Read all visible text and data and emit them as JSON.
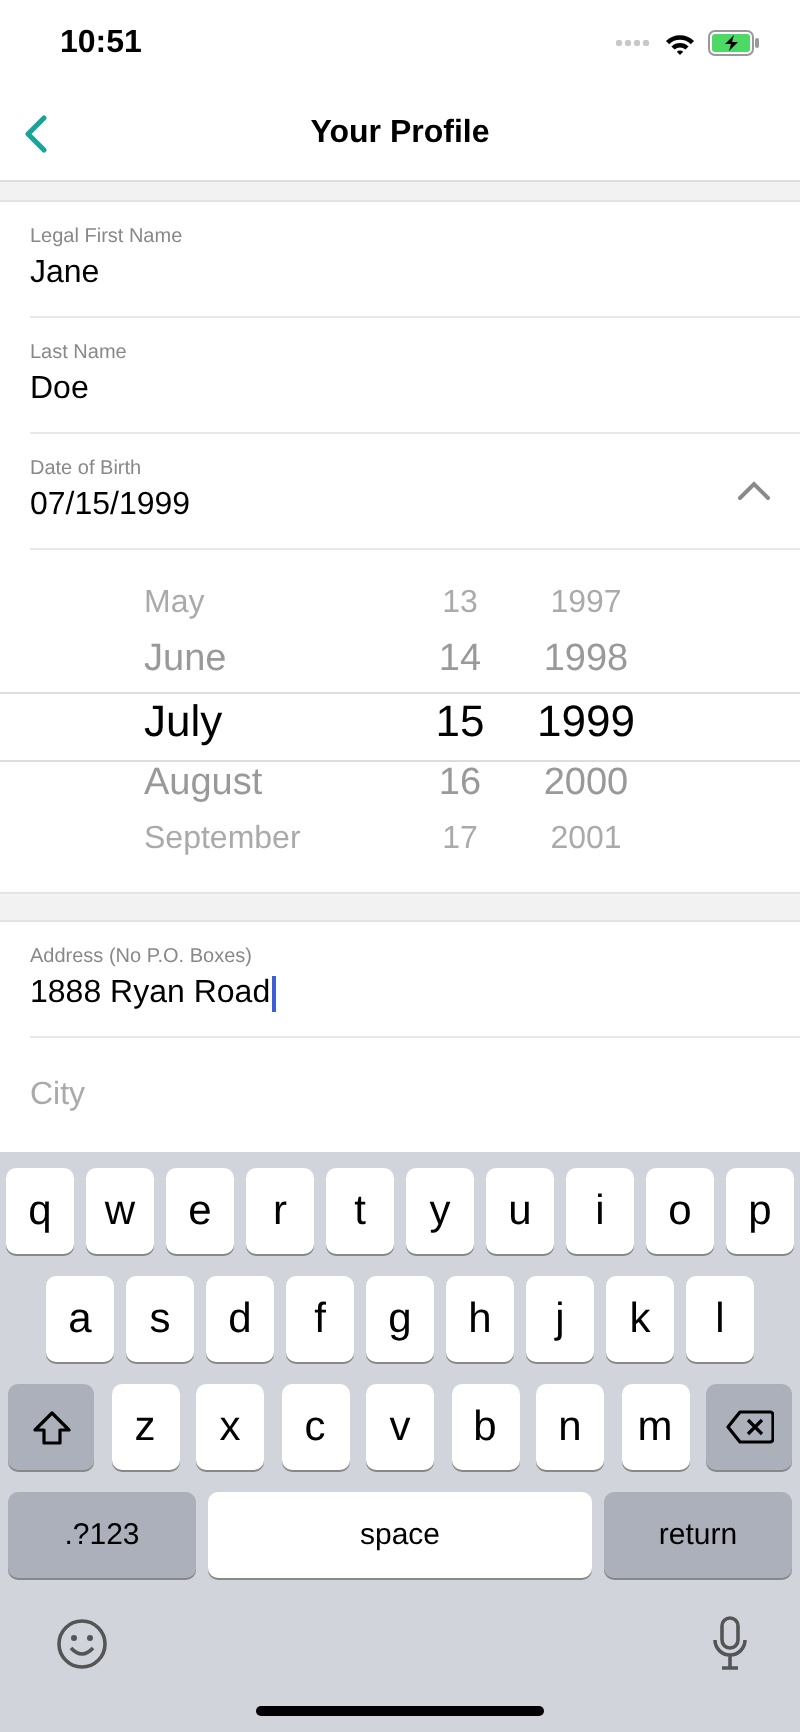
{
  "status_bar": {
    "time": "10:51",
    "charging": true
  },
  "nav": {
    "title": "Your Profile"
  },
  "fields": [
    {
      "label": "Legal First Name",
      "value": "Jane",
      "focused": false
    },
    {
      "label": "Last Name",
      "value": "Doe",
      "focused": false
    },
    {
      "label": "Date of Birth",
      "value": "07/15/1999",
      "expanded": true,
      "focused": false
    }
  ],
  "date_picker": {
    "columns": [
      {
        "items": [
          {
            "text": "May",
            "selected": false
          },
          {
            "text": "June",
            "selected": false
          },
          {
            "text": "July",
            "selected": true
          },
          {
            "text": "August",
            "selected": false
          },
          {
            "text": "September",
            "selected": false
          }
        ]
      },
      {
        "items": [
          {
            "text": "13",
            "selected": false
          },
          {
            "text": "14",
            "selected": false
          },
          {
            "text": "15",
            "selected": true
          },
          {
            "text": "16",
            "selected": false
          },
          {
            "text": "17",
            "selected": false
          }
        ]
      },
      {
        "items": [
          {
            "text": "1997",
            "selected": false
          },
          {
            "text": "1998",
            "selected": false
          },
          {
            "text": "1999",
            "selected": true
          },
          {
            "text": "2000",
            "selected": false
          },
          {
            "text": "2001",
            "selected": false
          }
        ]
      }
    ]
  },
  "address_fields": [
    {
      "label": "Address (No P.O. Boxes)",
      "value": "1888 Ryan Road",
      "focused": true
    },
    {
      "placeholder": "City",
      "focused": false
    }
  ],
  "keyboard": {
    "rows": [
      {
        "keys": [
          {
            "kind": "letter",
            "label": "q"
          },
          {
            "kind": "letter",
            "label": "w"
          },
          {
            "kind": "letter",
            "label": "e"
          },
          {
            "kind": "letter",
            "label": "r"
          },
          {
            "kind": "letter",
            "label": "t"
          },
          {
            "kind": "letter",
            "label": "y"
          },
          {
            "kind": "letter",
            "label": "u"
          },
          {
            "kind": "letter",
            "label": "i"
          },
          {
            "kind": "letter",
            "label": "o"
          },
          {
            "kind": "letter",
            "label": "p"
          }
        ]
      },
      {
        "keys": [
          {
            "kind": "letter",
            "label": "a"
          },
          {
            "kind": "letter",
            "label": "s"
          },
          {
            "kind": "letter",
            "label": "d"
          },
          {
            "kind": "letter",
            "label": "f"
          },
          {
            "kind": "letter",
            "label": "g"
          },
          {
            "kind": "letter",
            "label": "h"
          },
          {
            "kind": "letter",
            "label": "j"
          },
          {
            "kind": "letter",
            "label": "k"
          },
          {
            "kind": "letter",
            "label": "l"
          }
        ]
      },
      {
        "keys": [
          {
            "kind": "shift"
          },
          {
            "kind": "letter",
            "label": "z"
          },
          {
            "kind": "letter",
            "label": "x"
          },
          {
            "kind": "letter",
            "label": "c"
          },
          {
            "kind": "letter",
            "label": "v"
          },
          {
            "kind": "letter",
            "label": "b"
          },
          {
            "kind": "letter",
            "label": "n"
          },
          {
            "kind": "letter",
            "label": "m"
          },
          {
            "kind": "delete"
          }
        ]
      },
      {
        "keys": [
          {
            "kind": "mode",
            "label": ".?123"
          },
          {
            "kind": "space",
            "label": "space"
          },
          {
            "kind": "return",
            "label": "return"
          }
        ]
      }
    ]
  }
}
